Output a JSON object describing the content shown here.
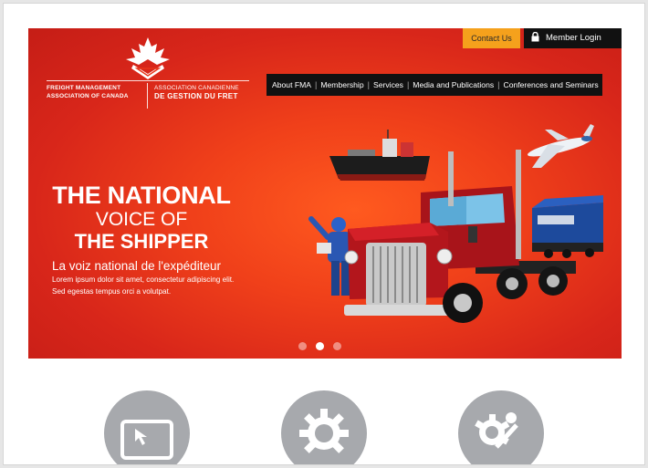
{
  "logo": {
    "en_line1": "FREIGHT MANAGEMENT",
    "en_line2": "ASSOCIATION OF CANADA",
    "fr_line1": "ASSOCIATION CANADIENNE",
    "fr_line2": "DE GESTION DU FRET",
    "icon": "maple-leaf-icon"
  },
  "topbar": {
    "contact_label": "Contact Us",
    "member_label": "Member Login",
    "member_icon": "lock-icon"
  },
  "nav": {
    "items": [
      {
        "label": "About FMA"
      },
      {
        "label": "Membership"
      },
      {
        "label": "Services"
      },
      {
        "label": "Media and Publications"
      },
      {
        "label": "Conferences and Seminars"
      }
    ]
  },
  "hero": {
    "headline_1": "THE NATIONAL",
    "headline_2": "VOICE OF",
    "headline_3": "THE SHIPPER",
    "subheadline": "La voiz national de l'expéditeur",
    "lorem_1": "Lorem ipsum dolor sit amet, consectetur adipiscing elit.",
    "lorem_2": "Sed egestas tempus orci a volutpat."
  },
  "slider": {
    "total": 3,
    "active_index": 1
  },
  "features": [
    {
      "icon": "laptop-cursor-icon"
    },
    {
      "icon": "gear-icon"
    },
    {
      "icon": "gear-wrench-icon"
    }
  ],
  "colors": {
    "hero_red": "#e8351b",
    "contact_orange": "#f5a11c",
    "nav_black": "#111111",
    "feature_gray": "#a7a9ad"
  }
}
